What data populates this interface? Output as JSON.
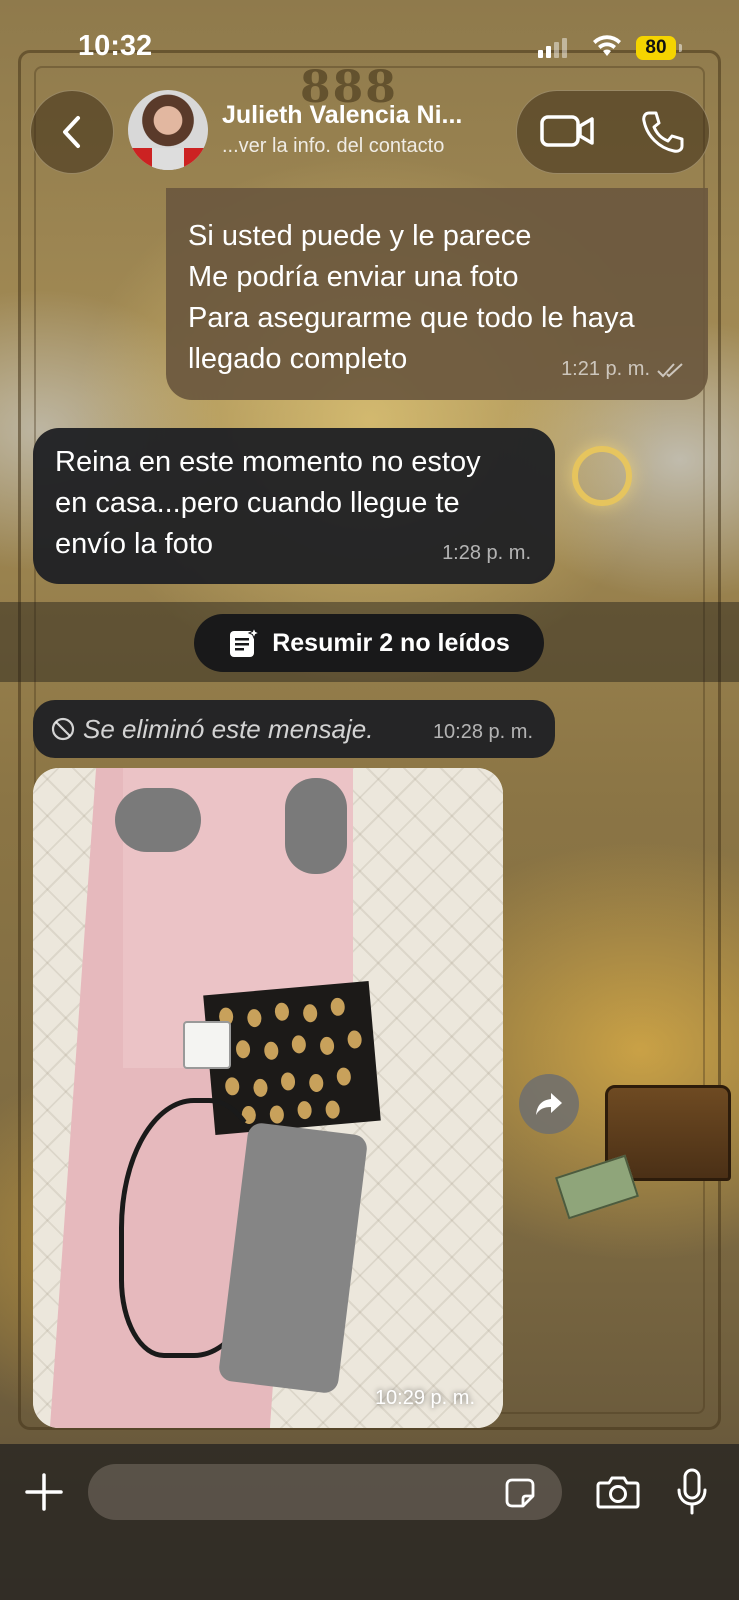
{
  "status_bar": {
    "time": "10:32",
    "battery": "80",
    "battery_color": "#f5d400"
  },
  "header": {
    "contact_name": "Julieth Valencia Ni...",
    "contact_subtitle": "...ver la info. del contacto",
    "back_icon": "chevron-left-icon",
    "video_icon": "video-camera-icon",
    "phone_icon": "phone-icon"
  },
  "wallpaper": {
    "number": "888"
  },
  "messages": [
    {
      "direction": "outgoing",
      "lines": [
        "Si usted puede y le parece",
        "Me podría enviar una foto",
        "Para asegurarme que todo le haya",
        "llegado completo"
      ],
      "time": "1:21 p. m.",
      "status": "read-double-check"
    },
    {
      "direction": "incoming",
      "lines": [
        "Reina en este momento no estoy",
        "en casa...pero cuando llegue te",
        "envío la foto"
      ],
      "time": "1:28 p. m."
    },
    {
      "direction": "incoming",
      "deleted": true,
      "text": "Se eliminó este mensaje.",
      "time": "10:28 p. m."
    },
    {
      "direction": "incoming",
      "type": "photo",
      "time": "10:29 p. m."
    }
  ],
  "unread_summary": {
    "label": "Resumir 2 no leídos",
    "icon": "summary-notes-icon"
  },
  "composer": {
    "placeholder": "",
    "icons": [
      "plus-icon",
      "sticker-icon",
      "camera-icon",
      "microphone-icon"
    ]
  },
  "colors": {
    "outgoing_bubble": "#6c583e",
    "incoming_bubble": "#202124",
    "battery": "#f5d400"
  }
}
